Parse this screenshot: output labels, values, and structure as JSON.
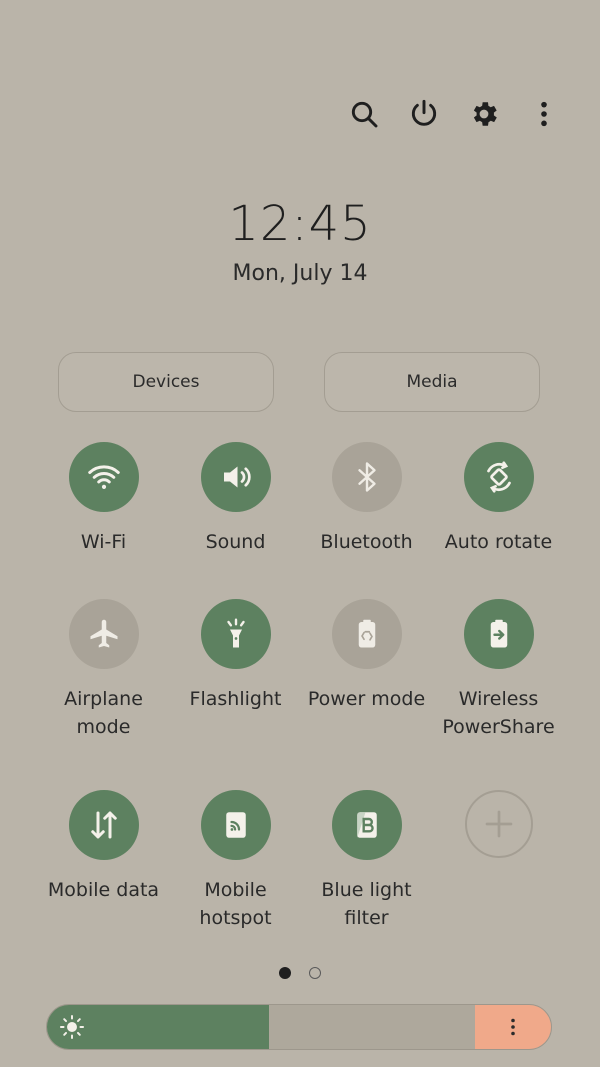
{
  "header": {
    "icons": [
      "search-icon",
      "power-icon",
      "gear-icon",
      "more-vert-icon"
    ]
  },
  "clock": {
    "time": "12:45",
    "date": "Mon, July 14"
  },
  "buttons": {
    "devices": "Devices",
    "media": "Media"
  },
  "tiles": [
    {
      "label": "Wi-Fi",
      "icon": "wifi-icon",
      "state": "on"
    },
    {
      "label": "Sound",
      "icon": "speaker-icon",
      "state": "on"
    },
    {
      "label": "Bluetooth",
      "icon": "bluetooth-icon",
      "state": "off"
    },
    {
      "label": "Auto rotate",
      "icon": "auto-rotate-icon",
      "state": "on"
    },
    {
      "label": "Airplane mode",
      "icon": "airplane-icon",
      "state": "off"
    },
    {
      "label": "Flashlight",
      "icon": "flashlight-icon",
      "state": "on"
    },
    {
      "label": "Power mode",
      "icon": "battery-recycle-icon",
      "state": "off"
    },
    {
      "label": "Wireless PowerShare",
      "icon": "battery-share-icon",
      "state": "on"
    },
    {
      "label": "Mobile data",
      "icon": "data-arrows-icon",
      "state": "on"
    },
    {
      "label": "Mobile hotspot",
      "icon": "hotspot-icon",
      "state": "on"
    },
    {
      "label": "Blue light filter",
      "icon": "blue-light-filter-icon",
      "state": "on"
    },
    {
      "label": "",
      "icon": "plus-icon",
      "state": "add"
    }
  ],
  "pager": {
    "pages": 2,
    "current": 1
  },
  "brightness": {
    "level": 0.44,
    "icon": "sun-icon",
    "menu_icon": "more-vert-icon"
  },
  "colors": {
    "accent": "#5d8160",
    "background": "#bab4a9",
    "inactive": "#a9a398",
    "extra": "#f0a98a"
  }
}
